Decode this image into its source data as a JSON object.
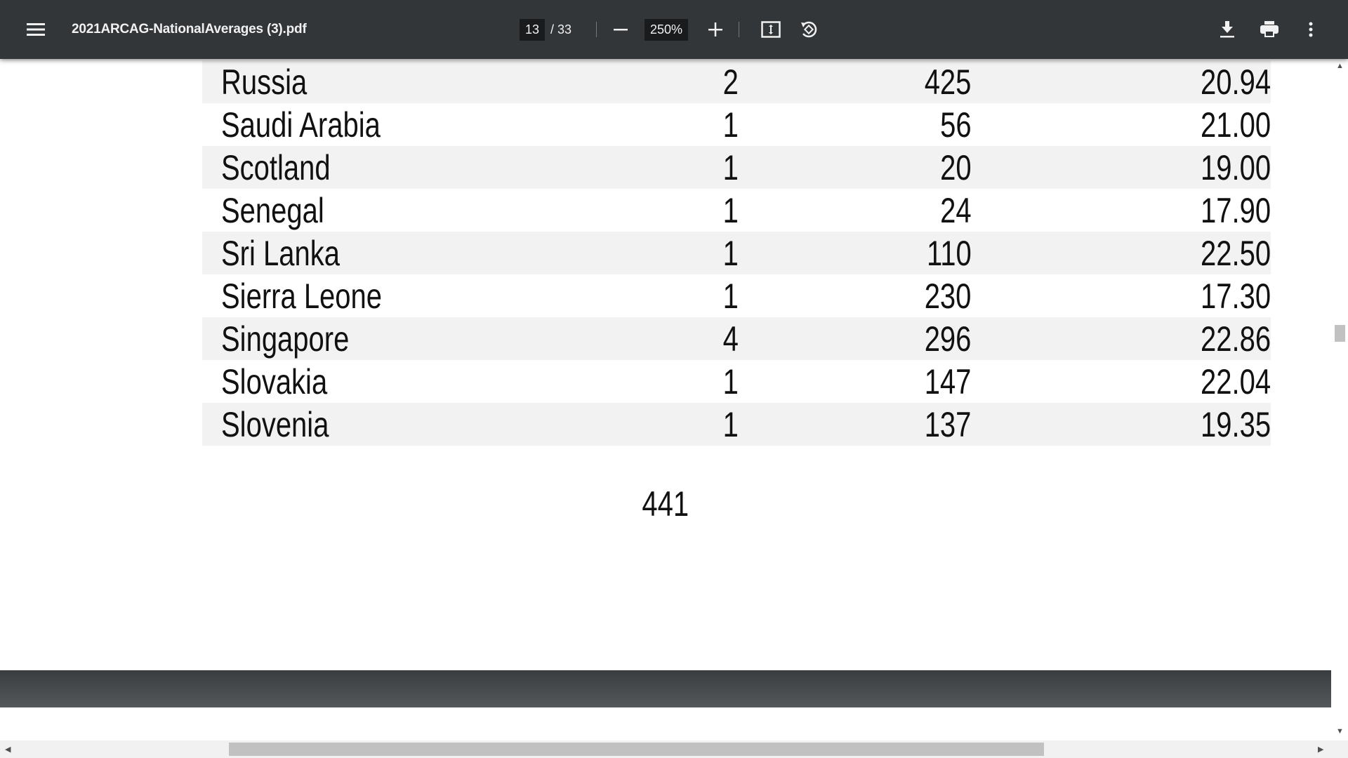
{
  "toolbar": {
    "title": "2021ARCAG-NationalAverages (3).pdf",
    "current_page": "13",
    "total_pages": "/ 33",
    "zoom": "250%",
    "icons": {
      "menu": "hamburger-icon",
      "zoom_out": "minus-icon",
      "zoom_in": "plus-icon",
      "fit": "fit-page-icon",
      "rotate": "rotate-icon",
      "download": "download-icon",
      "print": "print-icon",
      "more": "more-vertical-icon"
    }
  },
  "table": {
    "rows": [
      {
        "country": "Russia",
        "count": "2",
        "value": "425",
        "average": "20.94"
      },
      {
        "country": "Saudi Arabia",
        "count": "1",
        "value": "56",
        "average": "21.00"
      },
      {
        "country": "Scotland",
        "count": "1",
        "value": "20",
        "average": "19.00"
      },
      {
        "country": "Senegal",
        "count": "1",
        "value": "24",
        "average": "17.90"
      },
      {
        "country": "Sri Lanka",
        "count": "1",
        "value": "110",
        "average": "22.50"
      },
      {
        "country": "Sierra Leone",
        "count": "1",
        "value": "230",
        "average": "17.30"
      },
      {
        "country": "Singapore",
        "count": "4",
        "value": "296",
        "average": "22.86"
      },
      {
        "country": "Slovakia",
        "count": "1",
        "value": "147",
        "average": "22.04"
      },
      {
        "country": "Slovenia",
        "count": "1",
        "value": "137",
        "average": "19.35"
      }
    ]
  },
  "page_footer": "441",
  "colors": {
    "toolbar": "#323639",
    "row_shade": "#f2f2f2",
    "viewer_bg": "#525659"
  }
}
